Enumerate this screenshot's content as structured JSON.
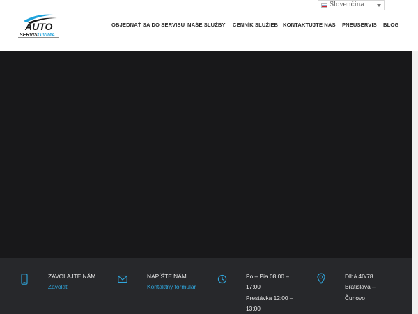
{
  "header": {
    "logo_top": "AUTO",
    "logo_bottom_left": "SERVIS",
    "logo_bottom_right": "GIVIMA",
    "language": {
      "selected": "Slovenčina"
    },
    "nav": [
      {
        "label": "OBJEDNAŤ SA DO SERVISU"
      },
      {
        "label": "NAŠE SLUŽBY"
      },
      {
        "label": "CENNÍK SLUŽIEB"
      },
      {
        "label": "KONTAKTUJTE NÁS"
      },
      {
        "label": "PNEUSERVIS"
      },
      {
        "label": "BLOG"
      }
    ]
  },
  "contact": {
    "call": {
      "title": "ZAVOLAJTE NÁM",
      "link": "Zavolať"
    },
    "write": {
      "title": "NAPÍŠTE NÁM",
      "link": "Kontaktný formulár"
    },
    "hours": {
      "line1": "Po – Pia 08:00 –",
      "line2": "17:00",
      "line3": "Prestávka 12:00 –",
      "line4": "13:00"
    },
    "address": {
      "line1": "Dlhá 40/78",
      "line2": "Bratislava –",
      "line3": "Čunovo"
    }
  },
  "colors": {
    "accent": "#2fa7de",
    "logo_blue": "#1fa3dc",
    "hero_bg": "#18181a",
    "contact_bg": "#27282b"
  }
}
